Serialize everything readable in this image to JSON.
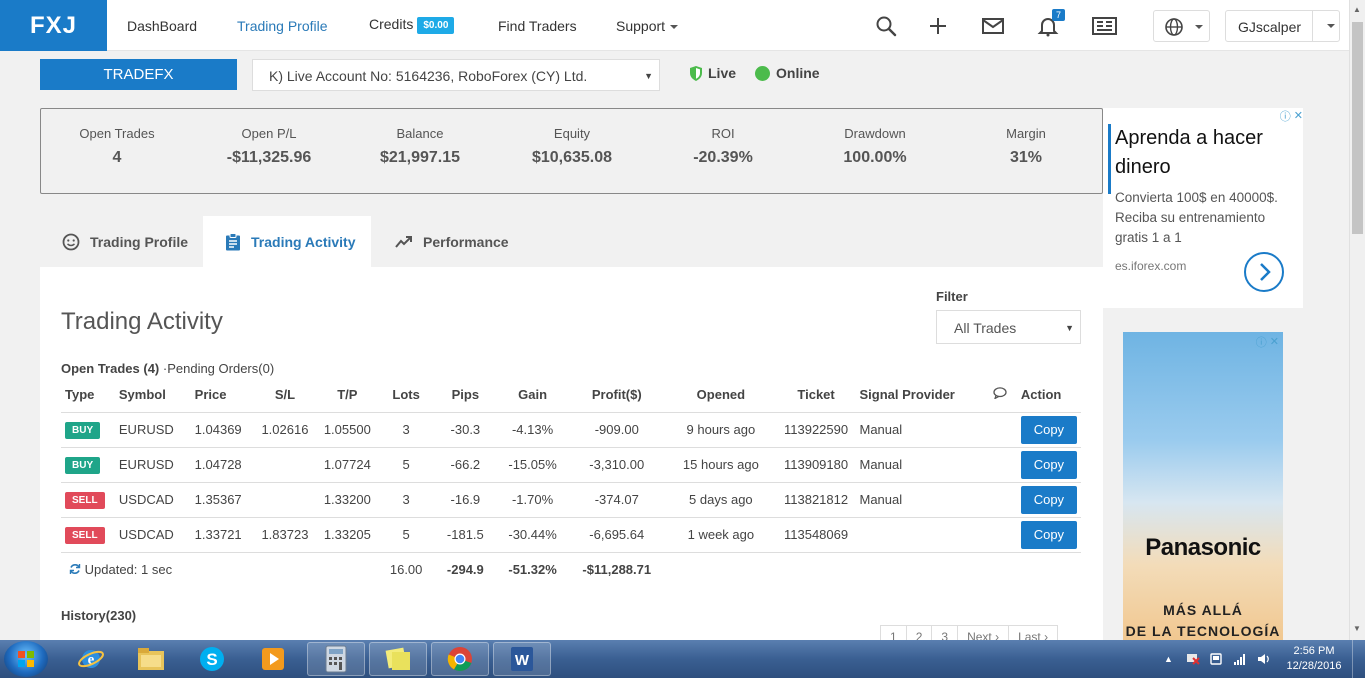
{
  "nav": {
    "logo": "FXJ",
    "dashboard": "DashBoard",
    "trading_profile": "Trading Profile",
    "credits": "Credits",
    "credits_amount": "$0.00",
    "find_traders": "Find Traders",
    "support": "Support",
    "notifications_count": "7",
    "username": "GJscalper"
  },
  "account": {
    "name": "TRADEFX",
    "selected": "K) Live Account No: 5164236, RoboForex (CY) Ltd.",
    "live_label": "Live",
    "online_label": "Online"
  },
  "stats": [
    {
      "label": "Open Trades",
      "value": "4"
    },
    {
      "label": "Open P/L",
      "value": "-$11,325.96"
    },
    {
      "label": "Balance",
      "value": "$21,997.15"
    },
    {
      "label": "Equity",
      "value": "$10,635.08"
    },
    {
      "label": "ROI",
      "value": "-20.39%"
    },
    {
      "label": "Drawdown",
      "value": "100.00%"
    },
    {
      "label": "Margin",
      "value": "31%"
    }
  ],
  "tabs": {
    "trading_profile": "Trading Profile",
    "trading_activity": "Trading Activity",
    "performance": "Performance"
  },
  "activity": {
    "title": "Trading Activity",
    "filter_label": "Filter",
    "filter_value": "All Trades",
    "open_trades_label": "Open Trades (4)",
    "pending_label": "·Pending Orders(0)",
    "columns": [
      "Type",
      "Symbol",
      "Price",
      "S/L",
      "T/P",
      "Lots",
      "Pips",
      "Gain",
      "Profit($)",
      "Opened",
      "Ticket",
      "Signal Provider",
      "",
      "Action"
    ],
    "rows": [
      {
        "type": "BUY",
        "symbol": "EURUSD",
        "price": "1.04369",
        "sl": "1.02616",
        "tp": "1.05500",
        "lots": "3",
        "pips": "-30.3",
        "gain": "-4.13%",
        "profit": "-909.00",
        "opened": "9 hours ago",
        "ticket": "113922590",
        "provider": "Manual",
        "action": "Copy"
      },
      {
        "type": "BUY",
        "symbol": "EURUSD",
        "price": "1.04728",
        "sl": "",
        "tp": "1.07724",
        "lots": "5",
        "pips": "-66.2",
        "gain": "-15.05%",
        "profit": "-3,310.00",
        "opened": "15 hours ago",
        "ticket": "113909180",
        "provider": "Manual",
        "action": "Copy"
      },
      {
        "type": "SELL",
        "symbol": "USDCAD",
        "price": "1.35367",
        "sl": "",
        "tp": "1.33200",
        "lots": "3",
        "pips": "-16.9",
        "gain": "-1.70%",
        "profit": "-374.07",
        "opened": "5 days ago",
        "ticket": "113821812",
        "provider": "Manual",
        "action": "Copy"
      },
      {
        "type": "SELL",
        "symbol": "USDCAD",
        "price": "1.33721",
        "sl": "1.83723",
        "tp": "1.33205",
        "lots": "5",
        "pips": "-181.5",
        "gain": "-30.44%",
        "profit": "-6,695.64",
        "opened": "1 week ago",
        "ticket": "113548069",
        "provider": "",
        "action": "Copy"
      }
    ],
    "totals": {
      "updated": "Updated: 1 sec",
      "lots": "16.00",
      "pips": "-294.9",
      "gain": "-51.32%",
      "profit": "-$11,288.71"
    },
    "history_label": "History(230)",
    "pager": [
      "1",
      "2",
      "3",
      "Next ›",
      "Last ›"
    ]
  },
  "ads": {
    "ad1_headline": "Aprenda a hacer dinero",
    "ad1_text": "Convierta 100$ en 40000$. Reciba su entrenamiento gratis 1 a 1",
    "ad1_domain": "es.iforex.com",
    "ad2_brand": "Panasonic",
    "ad2_tagline_1": "MÁS ALLÁ",
    "ad2_tagline_2": "DE LA TECNOLOGÍA"
  },
  "taskbar": {
    "time": "2:56 PM",
    "date": "12/28/2016"
  }
}
